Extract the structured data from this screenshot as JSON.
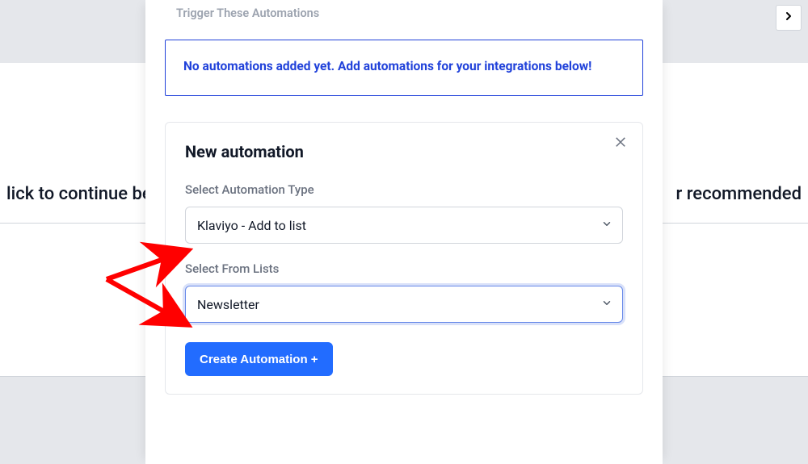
{
  "background": {
    "headline_left": "lick to continue be",
    "headline_right": "r recommended"
  },
  "modal": {
    "section_label": "Trigger These Automations",
    "info_text": "No automations added yet. Add automations for your integrations below!",
    "card": {
      "title": "New automation",
      "type_label": "Select Automation Type",
      "type_value": "Klaviyo - Add to list",
      "list_label": "Select From Lists",
      "list_value": "Newsletter",
      "create_btn": "Create Automation +"
    }
  }
}
